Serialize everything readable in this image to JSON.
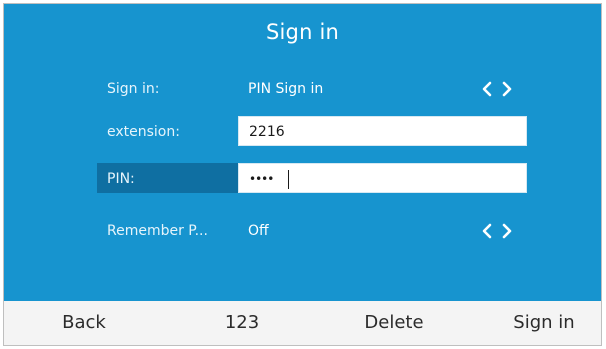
{
  "screen": {
    "title": "Sign in"
  },
  "fields": [
    {
      "label": "Sign in:",
      "value": "PIN Sign in",
      "arrows": "chevron-left-right-icon"
    },
    {
      "label": "extension:",
      "value": "2216"
    },
    {
      "label": "PIN:",
      "value": "••••"
    },
    {
      "label": "Remember P...",
      "value": "Off",
      "arrows": "chevron-left-right-icon"
    }
  ],
  "softkeys": {
    "back": "Back",
    "mode": "123",
    "delete": "Delete",
    "signin": "Sign in"
  },
  "colors": {
    "screen_background": "#1794cf",
    "selected_label": "#0f6fa2",
    "softkey_bar": "#f4f4f4"
  }
}
